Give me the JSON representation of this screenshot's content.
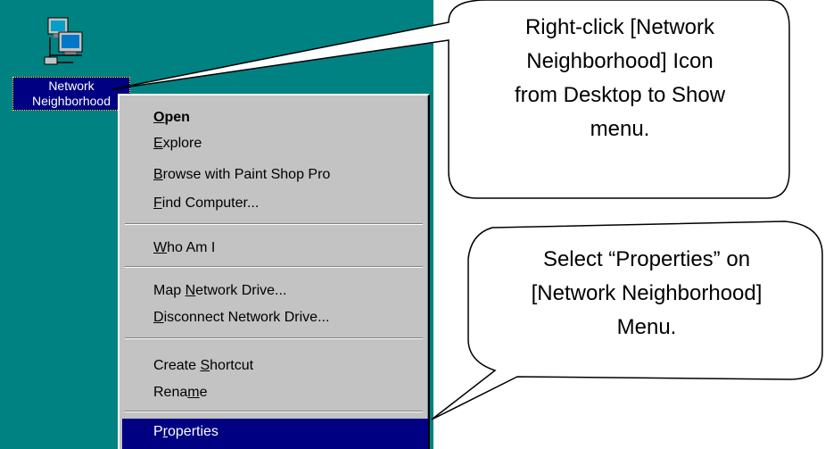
{
  "desktop": {
    "icon": {
      "name": "network-computer-icon",
      "label_line1": "Network",
      "label_line2": "Neighborhood"
    },
    "background_color": "#008282"
  },
  "context_menu": {
    "items": [
      {
        "label": "Open",
        "underline": "O",
        "bold": true
      },
      {
        "label": "Explore",
        "underline": "E"
      },
      {
        "label": "Browse with Paint Shop Pro",
        "underline": "B"
      },
      {
        "label": "Find Computer...",
        "underline": "F"
      },
      {
        "label": "Who Am I",
        "underline": "W"
      },
      {
        "label": "Map Network Drive...",
        "underline": "N"
      },
      {
        "label": "Disconnect Network Drive...",
        "underline": "D"
      },
      {
        "label": "Create Shortcut",
        "underline": "S"
      },
      {
        "label": "Rename",
        "underline": "m"
      },
      {
        "label": "Properties",
        "underline": "r",
        "highlighted": true
      }
    ],
    "highlight_color": "#000082"
  },
  "callouts": {
    "top": {
      "line1": "Right-click [Network",
      "line2": "Neighborhood] Icon",
      "line3": "from Desktop to Show",
      "line4": "menu."
    },
    "bottom": {
      "line1": "Select “Properties” on",
      "line2": "[Network Neighborhood]",
      "line3": "Menu."
    }
  }
}
